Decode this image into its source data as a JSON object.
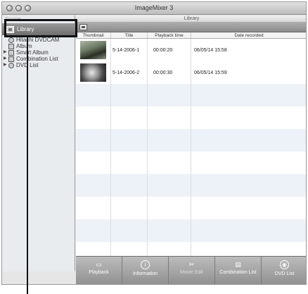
{
  "window": {
    "title": "ImageMixer 3"
  },
  "sidebar": {
    "source_label": "Source",
    "library_label": "Library",
    "items": [
      {
        "label": "Hitachi DVDCAM",
        "has_disclosure": false
      },
      {
        "label": "Album",
        "has_disclosure": false
      },
      {
        "label": "Smart Album",
        "has_disclosure": true
      },
      {
        "label": "Combination List",
        "has_disclosure": true
      },
      {
        "label": "DVD List",
        "has_disclosure": true
      }
    ],
    "bottom_buttons": [
      {
        "label": "+",
        "icon": "plus-icon"
      },
      {
        "label": "⚙▾",
        "icon": "gear-icon"
      }
    ]
  },
  "main": {
    "header": "Library",
    "columns": [
      "Thumbnail",
      "Title",
      "Playback time",
      "Date recorded"
    ],
    "rows": [
      {
        "title": "5-14-2006-1",
        "playback_time": "00:00:20",
        "date_recorded": "06/05/14 15:58"
      },
      {
        "title": "5-14-2006-2",
        "playback_time": "00:00:30",
        "date_recorded": "06/05/14 15:59"
      }
    ],
    "toolbar": [
      {
        "label": "Playback",
        "icon": "playback-icon"
      },
      {
        "label": "Information",
        "icon": "info-icon"
      },
      {
        "label": "Movie Edit",
        "icon": "scissors-icon"
      },
      {
        "label": "Combination List",
        "icon": "combination-list-icon"
      },
      {
        "label": "DVD List",
        "icon": "dvd-icon"
      }
    ]
  }
}
